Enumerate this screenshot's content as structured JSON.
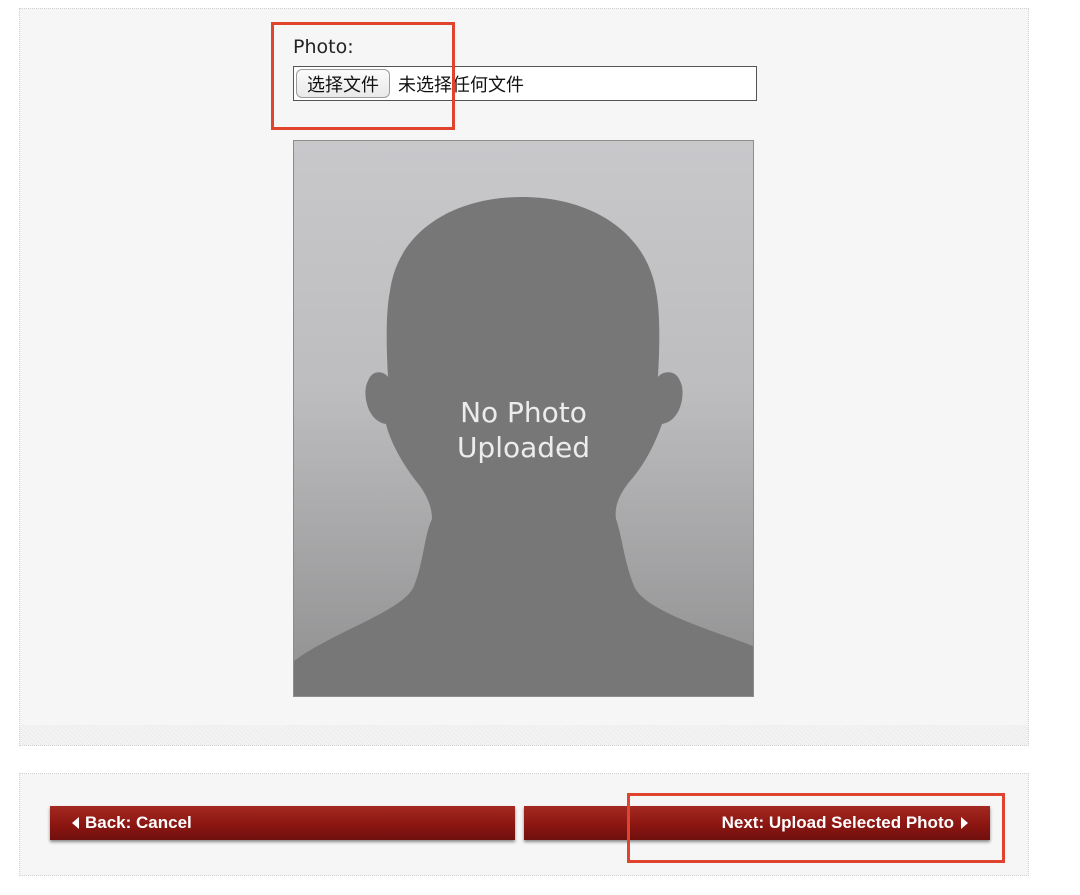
{
  "form": {
    "photo_label": "Photo:",
    "file_button_label": "选择文件",
    "file_status": "未选择任何文件"
  },
  "avatar": {
    "line1": "No Photo",
    "line2": "Uploaded"
  },
  "nav": {
    "back_label": "Back: Cancel",
    "next_label": "Next: Upload Selected Photo"
  },
  "icons": {
    "back": "caret-left-icon",
    "next": "caret-right-icon"
  },
  "colors": {
    "button_red": "#8c1612",
    "highlight": "#e0442f",
    "avatar_bg_top": "#c8c7ca",
    "avatar_silhouette": "#777777"
  }
}
